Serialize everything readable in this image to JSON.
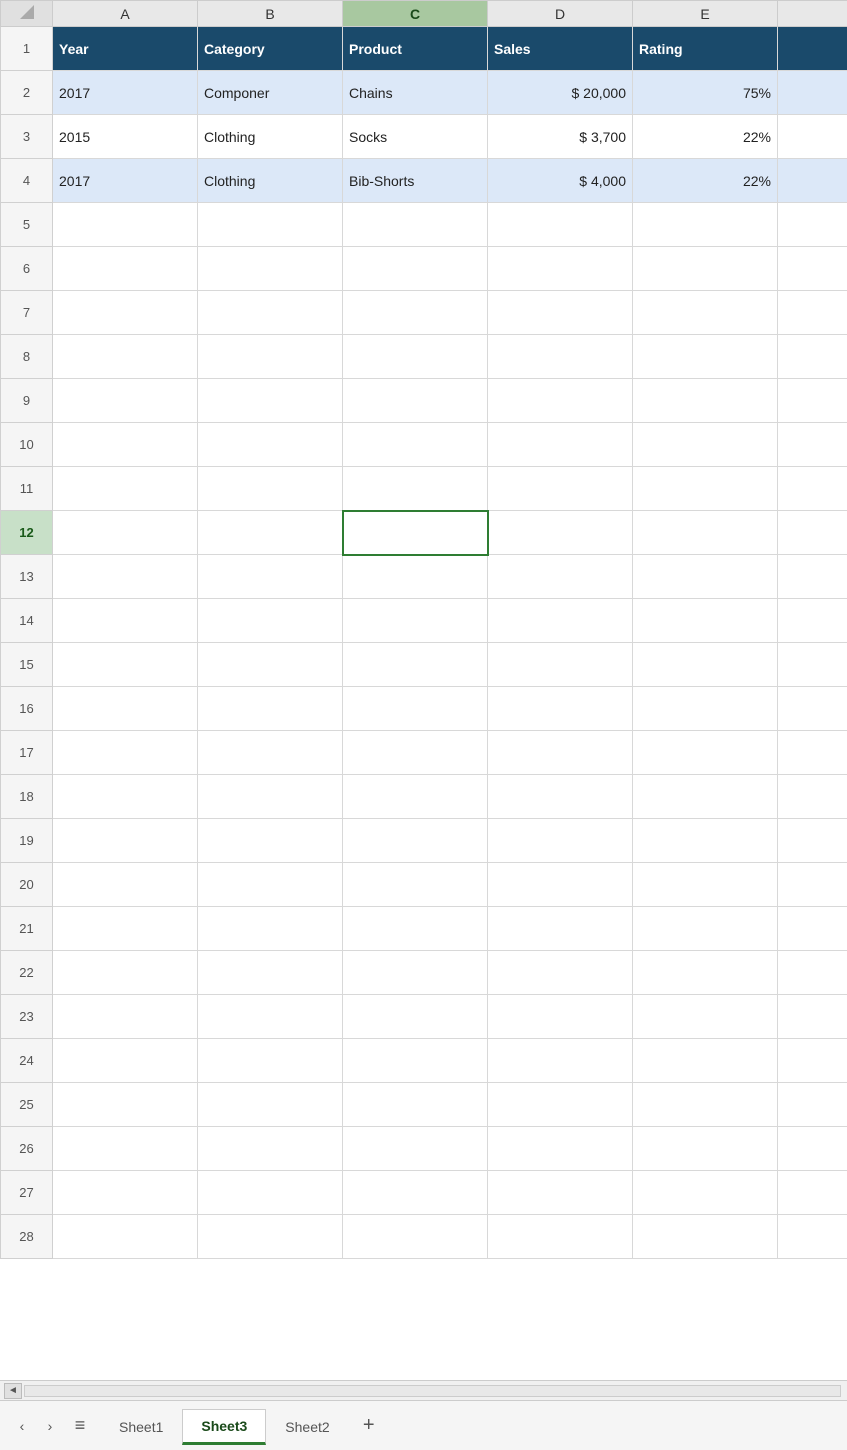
{
  "columns": {
    "corner": "",
    "headers": [
      "A",
      "B",
      "C",
      "D",
      "E"
    ],
    "selected": "C"
  },
  "header_row": {
    "row_num": "1",
    "cells": [
      "Year",
      "Category",
      "Product",
      "Sales",
      "Rating"
    ]
  },
  "data_rows": [
    {
      "row_num": "2",
      "shaded": true,
      "cells": [
        "2017",
        "Componer",
        "Chains",
        "$ 20,000",
        "75%"
      ]
    },
    {
      "row_num": "3",
      "shaded": false,
      "cells": [
        "2015",
        "Clothing",
        "Socks",
        "$  3,700",
        "22%"
      ]
    },
    {
      "row_num": "4",
      "shaded": true,
      "cells": [
        "2017",
        "Clothing",
        "Bib-Shorts",
        "$  4,000",
        "22%"
      ]
    }
  ],
  "empty_rows": [
    "5",
    "6",
    "7",
    "8",
    "9",
    "10",
    "11",
    "12",
    "13",
    "14",
    "15",
    "16",
    "17",
    "18",
    "19",
    "20",
    "21",
    "22",
    "23",
    "24",
    "25",
    "26",
    "27",
    "28"
  ],
  "active_cell": {
    "row": "12",
    "col": "C"
  },
  "tabs": {
    "nav": [
      "‹",
      "›"
    ],
    "menu": "≡",
    "sheets": [
      "Sheet1",
      "Sheet3",
      "Sheet2"
    ],
    "active": "Sheet3",
    "add": "+"
  }
}
